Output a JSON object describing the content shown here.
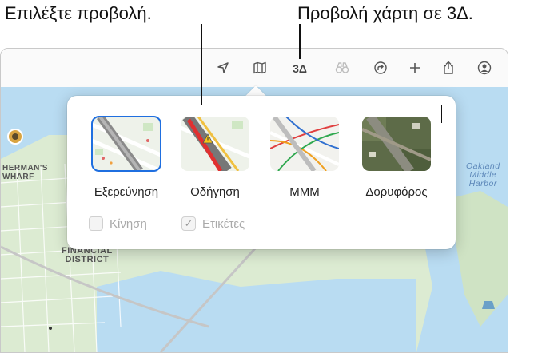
{
  "callouts": {
    "choose_view": "Επιλέξτε προβολή.",
    "map_3d": "Προβολή χάρτη σε 3Δ."
  },
  "toolbar": {
    "location_icon": "location-arrow-icon",
    "map_icon": "map-icon",
    "three_d_label": "3Δ",
    "lookaround_icon": "binoculars-icon",
    "directions_icon": "directions-icon",
    "add_icon": "plus-icon",
    "share_icon": "share-icon",
    "account_icon": "person-circle-icon"
  },
  "map": {
    "labels": {
      "wharf": "HERMAN'S\nWHARF",
      "financial": "FINANCIAL\nDISTRICT",
      "oakland": "Oakland\nMiddle\nHarbor"
    }
  },
  "popover": {
    "modes": [
      {
        "label": "Εξερεύνηση",
        "selected": true
      },
      {
        "label": "Οδήγηση",
        "selected": false
      },
      {
        "label": "ΜΜΜ",
        "selected": false
      },
      {
        "label": "Δορυφόρος",
        "selected": false
      }
    ],
    "checkboxes": [
      {
        "label": "Κίνηση",
        "checked": false
      },
      {
        "label": "Ετικέτες",
        "checked": true
      }
    ]
  },
  "colors": {
    "accent": "#1f6fe0",
    "water": "#b9dcf2",
    "land": "#dcebd2"
  }
}
